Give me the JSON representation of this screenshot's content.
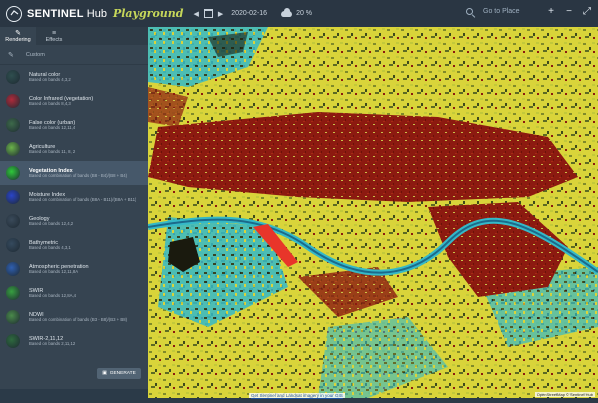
{
  "topbar": {
    "brand_name": "SENTINEL",
    "brand_sub": "Hub",
    "brand_tag": "Playground",
    "date": "2020-02-16",
    "cloud_percent": "20 %",
    "search_placeholder": "Go to Place",
    "zoom_in": "+",
    "zoom_out": "−",
    "fullscreen": "⤢"
  },
  "sidebar": {
    "tabs": [
      {
        "label": "Rendering",
        "icon": "brush-icon"
      },
      {
        "label": "Effects",
        "icon": "sliders-icon"
      }
    ],
    "custom_label": "Custom",
    "presets": [
      {
        "name": "Natural color",
        "desc": "Based on bands 4,3,2",
        "color": "#2f4f4f"
      },
      {
        "name": "Color Infrared (vegetation)",
        "desc": "Based on bands 8,4,3",
        "color": "#b02a3a"
      },
      {
        "name": "False color (urban)",
        "desc": "Based on bands 12,11,4",
        "color": "#3d6a4a"
      },
      {
        "name": "Agriculture",
        "desc": "Based on bands 11, 8, 2",
        "color": "#6bb34a"
      },
      {
        "name": "Vegetation Index",
        "desc": "Based on combination of bands (B8 - B4)/(B8 + B4)",
        "color": "#2ec93a",
        "active": true
      },
      {
        "name": "Moisture Index",
        "desc": "Based on combination of bands (B8A - B11)/(B8A + B11)",
        "color": "#2a44c8"
      },
      {
        "name": "Geology",
        "desc": "Based on bands 12,4,2",
        "color": "#3a4a5a"
      },
      {
        "name": "Bathymetric",
        "desc": "Based on bands 4,3,1",
        "color": "#354a5e"
      },
      {
        "name": "Atmospheric penetration",
        "desc": "Based on bands 12,11,8A",
        "color": "#2f5fb0"
      },
      {
        "name": "SWIR",
        "desc": "Based on bands 12,8A,4",
        "color": "#37a040"
      },
      {
        "name": "NDWI",
        "desc": "Based on combination of bands (B3 - B8)/(B3 + B8)",
        "color": "#4a8a4a"
      },
      {
        "name": "SWIR-2,11,12",
        "desc": "Based on bands 2,11,12",
        "color": "#2e6a3e"
      }
    ],
    "generate_label": "GENERATE"
  },
  "map": {
    "attribution": "OpenStreetMap © Sentinel Hub",
    "footer_link": "Get Sentinel and Landsat imagery in your GIS",
    "colors": {
      "vegetation": "#d9d43a",
      "urban": "#8c1a10",
      "water_edge": "#34b9c8",
      "dark": "#1a1a0e",
      "red_patch": "#e8352a"
    }
  }
}
